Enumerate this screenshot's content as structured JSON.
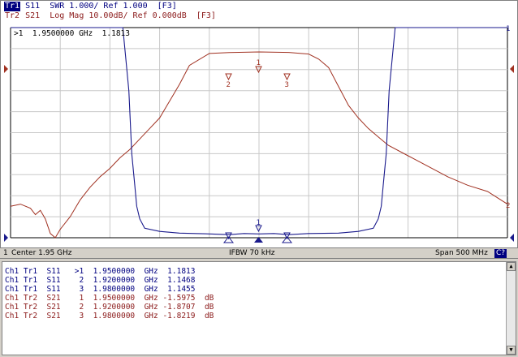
{
  "header": {
    "trace1": {
      "tag": "Tr1",
      "text": "S11  SWR 1.000/ Ref 1.000  [F3]"
    },
    "trace2": {
      "tag": "Tr2",
      "text": "S21  Log Mag 10.00dB/ Ref 0.000dB  [F3]"
    }
  },
  "active_marker": ">1  1.9500000 GHz  1.1813",
  "scale_labels": {
    "right_top": "1",
    "right_mid": "2"
  },
  "markers": {
    "m1": "1",
    "m2": "2",
    "m3": "3"
  },
  "status": {
    "channel": "1",
    "center": "Center 1.95 GHz",
    "ifbw": "IFBW 70 kHz",
    "span": "Span 500 MHz",
    "badge": "C?"
  },
  "marker_table": [
    "Ch1 Tr1  S11   >1  1.9500000  GHz  1.1813",
    "Ch1 Tr1  S11    2  1.9200000  GHz  1.1468",
    "Ch1 Tr1  S11    3  1.9800000  GHz  1.1455",
    "Ch1 Tr2  S21    1  1.9500000  GHz -1.5975  dB",
    "Ch1 Tr2  S21    2  1.9200000  GHz -1.8707  dB",
    "Ch1 Tr2  S21    3  1.9800000  GHz -1.8219  dB"
  ],
  "colors": {
    "trace1": "#1a1a8c",
    "trace2": "#a03020",
    "grid": "#c8c8c8"
  },
  "chart_data": {
    "type": "line",
    "title": "",
    "xlabel": "",
    "ylabel": "",
    "xlim": [
      1.7,
      2.2
    ],
    "x_unit": "GHz",
    "grid": true,
    "series": [
      {
        "name": "S11",
        "unit": "SWR",
        "ylim": [
          1.0,
          11.0
        ],
        "x": [
          1.7,
          1.8,
          1.813,
          1.819,
          1.822,
          1.825,
          1.827,
          1.83,
          1.835,
          1.85,
          1.87,
          1.9,
          1.92,
          1.935,
          1.95,
          1.965,
          1.98,
          2.0,
          2.03,
          2.05,
          2.065,
          2.07,
          2.073,
          2.075,
          2.078,
          2.081,
          2.087,
          2.1,
          2.2
        ],
        "y": [
          11.0,
          11.0,
          11.0,
          8.0,
          5.0,
          3.5,
          2.5,
          1.9,
          1.45,
          1.3,
          1.22,
          1.18,
          1.1468,
          1.2,
          1.1813,
          1.2,
          1.1455,
          1.2,
          1.22,
          1.3,
          1.45,
          1.9,
          2.5,
          3.5,
          5.0,
          8.0,
          11.0,
          11.0,
          11.0
        ]
      },
      {
        "name": "S21",
        "unit": "dB",
        "ylim": [
          -90,
          10
        ],
        "x": [
          1.7,
          1.71,
          1.72,
          1.725,
          1.73,
          1.735,
          1.74,
          1.745,
          1.75,
          1.76,
          1.77,
          1.78,
          1.79,
          1.8,
          1.81,
          1.82,
          1.83,
          1.84,
          1.85,
          1.86,
          1.87,
          1.88,
          1.9,
          1.92,
          1.95,
          1.98,
          2.0,
          2.01,
          2.02,
          2.03,
          2.04,
          2.05,
          2.06,
          2.07,
          2.08,
          2.1,
          2.12,
          2.14,
          2.16,
          2.18,
          2.19,
          2.2
        ],
        "y": [
          -75,
          -74,
          -76,
          -79,
          -77,
          -81,
          -88,
          -90,
          -86,
          -80,
          -72,
          -66,
          -61,
          -57,
          -52,
          -48,
          -43,
          -38,
          -33,
          -25,
          -17,
          -8,
          -2.3,
          -1.8707,
          -1.5975,
          -1.8219,
          -2.6,
          -5,
          -9,
          -18,
          -27,
          -33,
          -38,
          -42,
          -46,
          -51,
          -56,
          -61,
          -65,
          -68,
          -71,
          -74
        ]
      }
    ]
  }
}
